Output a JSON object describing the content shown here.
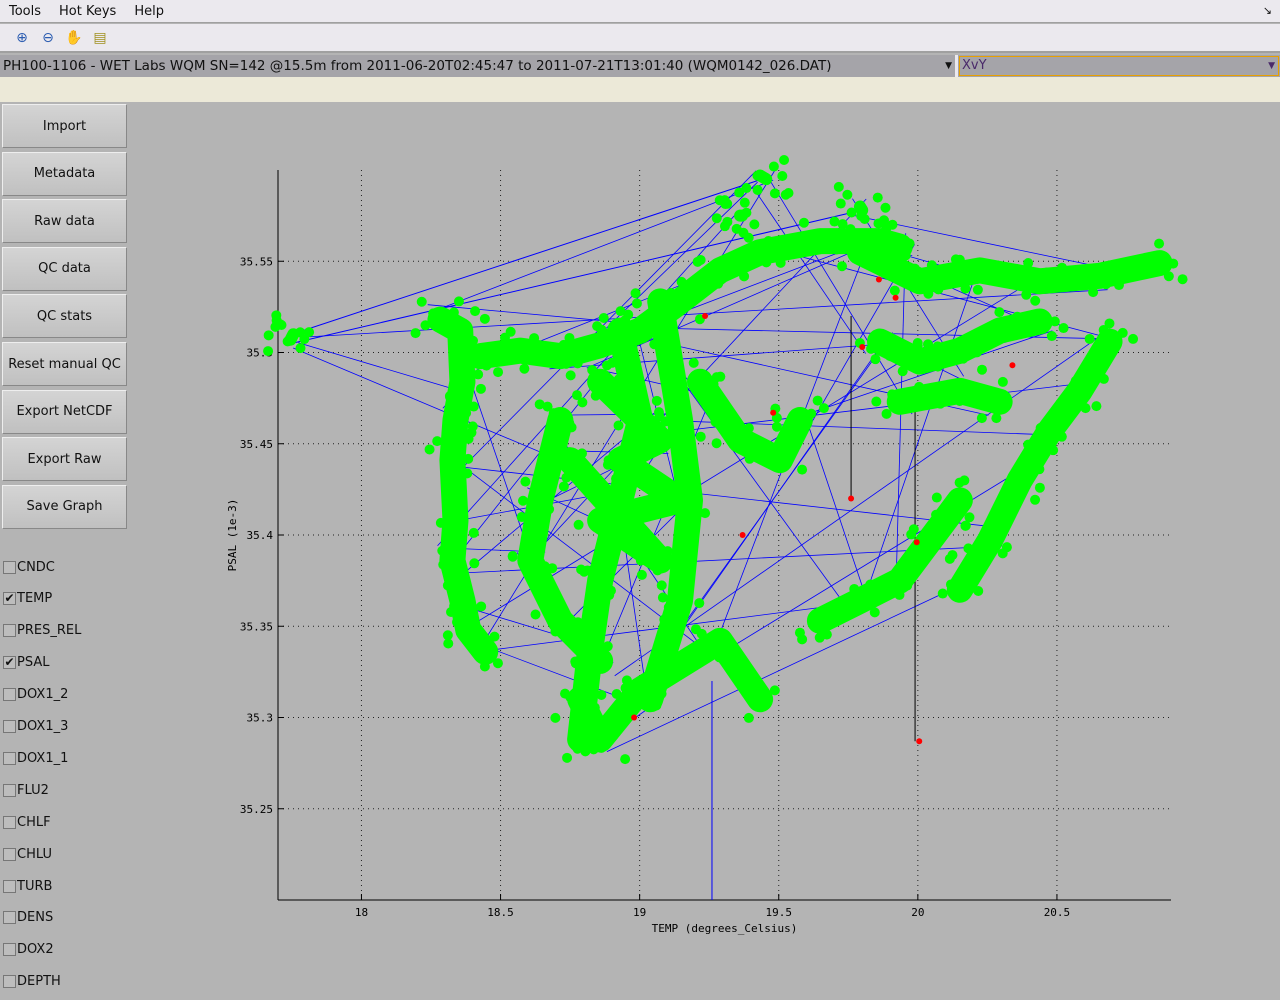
{
  "menu": [
    "Tools",
    "Hot Keys",
    "Help"
  ],
  "toolbar": [
    {
      "icon": "zoom-in-icon",
      "glyph": "⊕"
    },
    {
      "icon": "zoom-out-icon",
      "glyph": "⊖"
    },
    {
      "icon": "pan-hand-icon",
      "glyph": "✋"
    },
    {
      "icon": "data-cursor-icon",
      "glyph": "▤"
    }
  ],
  "dataset_select": "PH100-1106 - WET Labs WQM SN=142 @15.5m from 2011-06-20T02:45:47 to 2011-07-21T13:01:40 (WQM0142_026.DAT)",
  "plot_type_select": "XvY",
  "buttons": [
    "Import",
    "Metadata",
    "Raw data",
    "QC data",
    "QC stats",
    "Reset manual QC",
    "Export NetCDF",
    "Export Raw",
    "Save Graph"
  ],
  "variables": [
    {
      "name": "CNDC",
      "checked": false
    },
    {
      "name": "TEMP",
      "checked": true
    },
    {
      "name": "PRES_REL",
      "checked": false
    },
    {
      "name": "PSAL",
      "checked": true
    },
    {
      "name": "DOX1_2",
      "checked": false
    },
    {
      "name": "DOX1_3",
      "checked": false
    },
    {
      "name": "DOX1_1",
      "checked": false
    },
    {
      "name": "FLU2",
      "checked": false
    },
    {
      "name": "CHLF",
      "checked": false
    },
    {
      "name": "CHLU",
      "checked": false
    },
    {
      "name": "TURB",
      "checked": false
    },
    {
      "name": "DENS",
      "checked": false
    },
    {
      "name": "DOX2",
      "checked": false
    },
    {
      "name": "DEPTH",
      "checked": false
    }
  ],
  "chart_data": {
    "type": "scatter",
    "xlabel": "TEMP (degrees_Celsius)",
    "ylabel": "PSAL (1e-3)",
    "xlim": [
      17.7,
      20.91
    ],
    "ylim": [
      35.2,
      35.6
    ],
    "xticks": [
      "18",
      "18.5",
      "19",
      "19.5",
      "20",
      "20.5"
    ],
    "yticks": [
      "35.25",
      "35.3",
      "35.35",
      "35.4",
      "35.45",
      "35.5",
      "35.55"
    ],
    "grid": true,
    "colors": {
      "good": "#00ff00",
      "flagged": "#ff0000",
      "line": "#0000ff",
      "axes_bg": "#b4b4b4"
    },
    "good_data_bands": [
      [
        [
          18.284,
          35.518
        ],
        [
          18.355,
          35.512
        ],
        [
          18.363,
          35.484
        ],
        [
          18.338,
          35.463
        ],
        [
          18.327,
          35.441
        ],
        [
          18.338,
          35.408
        ],
        [
          18.327,
          35.386
        ],
        [
          18.363,
          35.364
        ],
        [
          18.384,
          35.348
        ],
        [
          18.445,
          35.336
        ]
      ],
      [
        [
          18.427,
          35.498
        ],
        [
          18.571,
          35.501
        ],
        [
          18.715,
          35.498
        ],
        [
          18.858,
          35.504
        ],
        [
          19.002,
          35.512
        ],
        [
          19.145,
          35.528
        ],
        [
          19.289,
          35.545
        ],
        [
          19.433,
          35.555
        ],
        [
          19.648,
          35.561
        ],
        [
          19.864,
          35.561
        ],
        [
          19.935,
          35.558
        ]
      ],
      [
        [
          18.93,
          35.512
        ],
        [
          19.002,
          35.463
        ],
        [
          18.93,
          35.419
        ],
        [
          18.858,
          35.375
        ],
        [
          18.822,
          35.337
        ],
        [
          18.786,
          35.288
        ]
      ],
      [
        [
          19.074,
          35.528
        ],
        [
          19.145,
          35.463
        ],
        [
          19.181,
          35.419
        ],
        [
          19.145,
          35.364
        ],
        [
          19.038,
          35.31
        ]
      ],
      [
        [
          18.715,
          35.463
        ],
        [
          18.643,
          35.419
        ],
        [
          18.607,
          35.386
        ],
        [
          18.715,
          35.353
        ],
        [
          18.858,
          35.331
        ]
      ],
      [
        [
          19.217,
          35.484
        ],
        [
          19.361,
          35.452
        ],
        [
          19.504,
          35.441
        ],
        [
          19.576,
          35.463
        ]
      ],
      [
        [
          18.858,
          35.484
        ],
        [
          19.074,
          35.452
        ],
        [
          18.93,
          35.441
        ],
        [
          19.145,
          35.419
        ],
        [
          18.858,
          35.408
        ],
        [
          19.074,
          35.386
        ],
        [
          18.75,
          35.441
        ]
      ],
      [
        [
          19.792,
          35.555
        ],
        [
          20.007,
          35.539
        ],
        [
          20.223,
          35.545
        ],
        [
          20.438,
          35.539
        ],
        [
          20.653,
          35.542
        ],
        [
          20.869,
          35.549
        ]
      ],
      [
        [
          19.864,
          35.506
        ],
        [
          20.007,
          35.495
        ],
        [
          20.151,
          35.501
        ],
        [
          20.294,
          35.512
        ],
        [
          20.438,
          35.517
        ]
      ],
      [
        [
          19.935,
          35.473
        ],
        [
          20.151,
          35.479
        ],
        [
          20.294,
          35.473
        ]
      ],
      [
        [
          20.689,
          35.506
        ],
        [
          20.582,
          35.479
        ],
        [
          20.474,
          35.457
        ],
        [
          20.366,
          35.43
        ],
        [
          20.259,
          35.397
        ],
        [
          20.151,
          35.37
        ]
      ],
      [
        [
          19.648,
          35.353
        ],
        [
          19.792,
          35.364
        ],
        [
          19.935,
          35.375
        ],
        [
          20.043,
          35.397
        ],
        [
          20.151,
          35.419
        ]
      ],
      [
        [
          18.786,
          35.31
        ],
        [
          18.858,
          35.288
        ],
        [
          19.002,
          35.315
        ],
        [
          19.289,
          35.342
        ],
        [
          19.433,
          35.31
        ]
      ],
      [
        [
          19.433,
          35.597
        ],
        [
          19.455,
          35.595
        ]
      ],
      [
        [
          19.792,
          35.58
        ],
        [
          19.8,
          35.578
        ]
      ],
      [
        [
          17.745,
          35.507
        ],
        [
          17.755,
          35.51
        ]
      ],
      [
        [
          19.361,
          35.575
        ],
        [
          19.368,
          35.575
        ]
      ]
    ],
    "flagged_points": [
      [
        19.235,
        35.52
      ],
      [
        19.86,
        35.54
      ],
      [
        19.92,
        35.53
      ],
      [
        19.8,
        35.503
      ],
      [
        19.48,
        35.467
      ],
      [
        19.76,
        35.42
      ],
      [
        19.37,
        35.4
      ],
      [
        19.996,
        35.396
      ],
      [
        20.34,
        35.493
      ],
      [
        18.98,
        35.3
      ],
      [
        20.005,
        35.287
      ]
    ]
  }
}
